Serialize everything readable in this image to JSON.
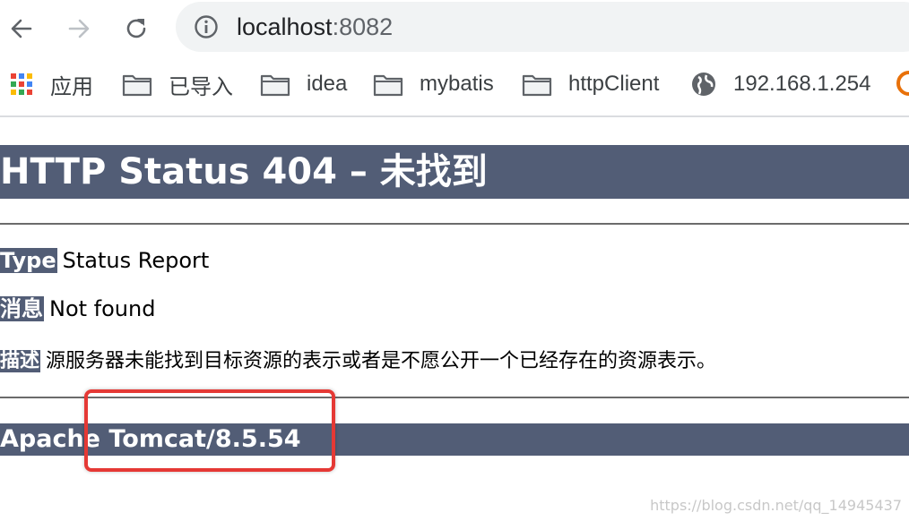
{
  "toolbar": {
    "back_icon": "arrow-left-icon",
    "forward_icon": "arrow-right-icon",
    "reload_icon": "reload-icon",
    "site_info_icon": "info-icon",
    "url_host": "localhost",
    "url_port": ":8082"
  },
  "bookmarks": [
    {
      "icon": "apps-grid-icon",
      "label": "应用"
    },
    {
      "icon": "folder-icon",
      "label": "已导入"
    },
    {
      "icon": "folder-icon",
      "label": "idea"
    },
    {
      "icon": "folder-icon",
      "label": "mybatis"
    },
    {
      "icon": "folder-icon",
      "label": "httpClient"
    },
    {
      "icon": "globe-icon",
      "label": "192.168.1.254"
    }
  ],
  "page": {
    "heading": "HTTP Status 404 – 未找到",
    "type_label": "Type",
    "type_value": "Status Report",
    "message_label": "消息",
    "message_value": "Not found",
    "description_label": "描述",
    "description_value": "源服务器未能找到目标资源的表示或者是不愿公开一个已经存在的资源表示。",
    "server_info": "Apache Tomcat/8.5.54"
  },
  "watermark": "https://blog.csdn.net/qq_14945437",
  "colors": {
    "tomcat_bar": "#525d76",
    "highlight_box": "#e53935",
    "omnibox_bg": "#f1f3f4"
  }
}
